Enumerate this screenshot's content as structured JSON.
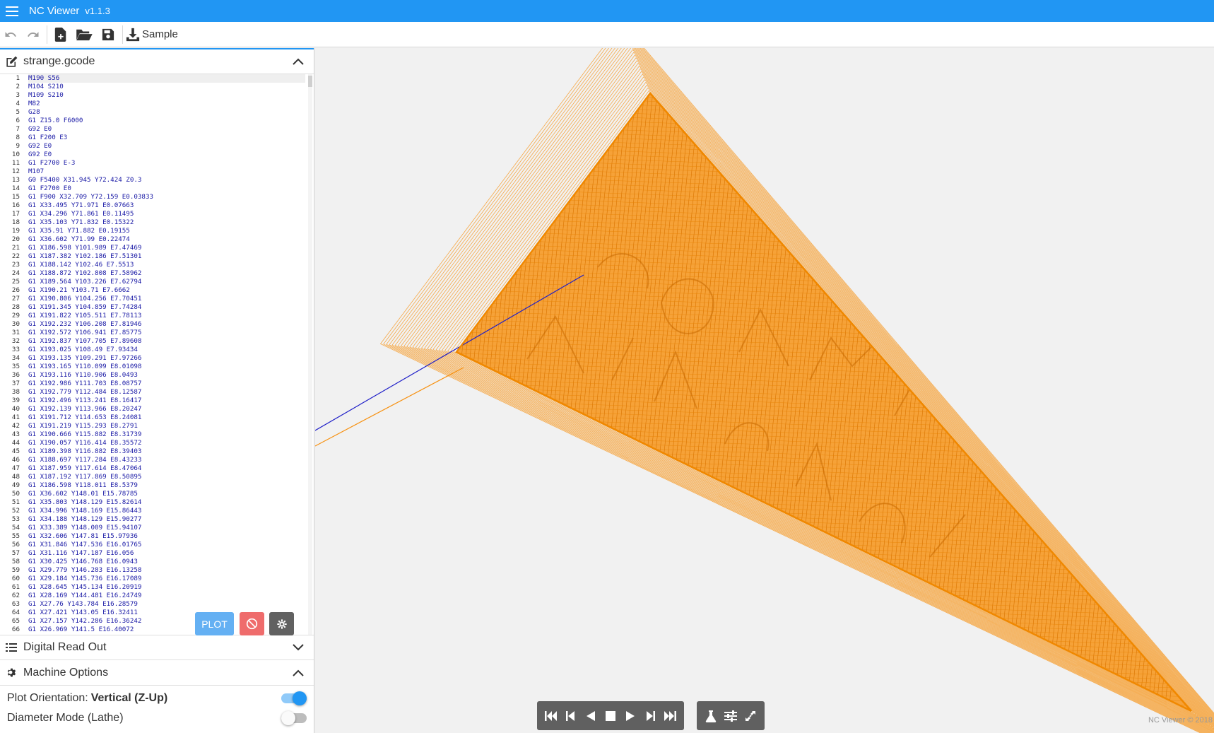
{
  "app": {
    "title": "NC Viewer",
    "version": "v1.1.3"
  },
  "toolbar": {
    "undo_icon": "undo-icon",
    "redo_icon": "redo-icon",
    "new_icon": "new-file-icon",
    "open_icon": "folder-open-icon",
    "save_icon": "save-icon",
    "sample_label": "Sample"
  },
  "editor": {
    "filename": "strange.gcode",
    "lines": [
      "M190 S56",
      "M104 S210",
      "M109 S210",
      "M82",
      "G28",
      "G1 Z15.0 F6000",
      "G92 E0",
      "G1 F200 E3",
      "G92 E0",
      "G92 E0",
      "G1 F2700 E-3",
      "M107",
      "G0 F5400 X31.945 Y72.424 Z0.3",
      "G1 F2700 E0",
      "G1 F900 X32.709 Y72.159 E0.03833",
      "G1 X33.495 Y71.971 E0.07663",
      "G1 X34.296 Y71.861 E0.11495",
      "G1 X35.103 Y71.832 E0.15322",
      "G1 X35.91 Y71.882 E0.19155",
      "G1 X36.602 Y71.99 E0.22474",
      "G1 X186.598 Y101.989 E7.47469",
      "G1 X187.382 Y102.186 E7.51301",
      "G1 X188.142 Y102.46 E7.5513",
      "G1 X188.872 Y102.808 E7.58962",
      "G1 X189.564 Y103.226 E7.62794",
      "G1 X190.21 Y103.71 E7.6662",
      "G1 X190.806 Y104.256 E7.70451",
      "G1 X191.345 Y104.859 E7.74284",
      "G1 X191.822 Y105.511 E7.78113",
      "G1 X192.232 Y106.208 E7.81946",
      "G1 X192.572 Y106.941 E7.85775",
      "G1 X192.837 Y107.705 E7.89608",
      "G1 X193.025 Y108.49 E7.93434",
      "G1 X193.135 Y109.291 E7.97266",
      "G1 X193.165 Y110.099 E8.01098",
      "G1 X193.116 Y110.906 E8.0493",
      "G1 X192.986 Y111.703 E8.08757",
      "G1 X192.779 Y112.484 E8.12587",
      "G1 X192.496 Y113.241 E8.16417",
      "G1 X192.139 Y113.966 E8.20247",
      "G1 X191.712 Y114.653 E8.24081",
      "G1 X191.219 Y115.293 E8.2791",
      "G1 X190.666 Y115.882 E8.31739",
      "G1 X190.057 Y116.414 E8.35572",
      "G1 X189.398 Y116.882 E8.39403",
      "G1 X188.697 Y117.284 E8.43233",
      "G1 X187.959 Y117.614 E8.47064",
      "G1 X187.192 Y117.869 E8.50895",
      "G1 X186.598 Y118.011 E8.5379",
      "G1 X36.602 Y148.01 E15.78785",
      "G1 X35.803 Y148.129 E15.82614",
      "G1 X34.996 Y148.169 E15.86443",
      "G1 X34.188 Y148.129 E15.90277",
      "G1 X33.389 Y148.009 E15.94107",
      "G1 X32.606 Y147.81 E15.97936",
      "G1 X31.846 Y147.536 E16.01765",
      "G1 X31.116 Y147.187 E16.056",
      "G1 X30.425 Y146.768 E16.0943",
      "G1 X29.779 Y146.283 E16.13258",
      "G1 X29.184 Y145.736 E16.17089",
      "G1 X28.645 Y145.134 E16.20919",
      "G1 X28.169 Y144.481 E16.24749",
      "G1 X27.76 Y143.784 E16.28579",
      "G1 X27.421 Y143.05 E16.32411",
      "G1 X27.157 Y142.286 E16.36242",
      "G1 X26.969 Y141.5 E16.40072"
    ],
    "buttons": {
      "plot": "PLOT",
      "clear_icon": "block-icon",
      "settings_icon": "gear-icon"
    }
  },
  "panels": {
    "dro": {
      "label": "Digital Read Out"
    },
    "machine": {
      "label": "Machine Options"
    }
  },
  "options": {
    "plot_orientation_label": "Plot Orientation:",
    "plot_orientation_value": "Vertical (Z-Up)",
    "plot_orientation_on": true,
    "diameter_mode_label": "Diameter Mode (Lathe)",
    "diameter_mode_on": false
  },
  "viewport": {
    "credit": "NC Viewer © 2018",
    "colors": {
      "path": "#f7900f",
      "travel": "#1f1fc8"
    }
  },
  "player": {
    "buttons": [
      "skip-start-icon",
      "step-back-icon",
      "play-reverse-icon",
      "stop-icon",
      "play-icon",
      "step-forward-icon",
      "skip-end-icon"
    ],
    "tools": [
      "flask-icon",
      "sliders-icon",
      "expand-icon"
    ]
  }
}
